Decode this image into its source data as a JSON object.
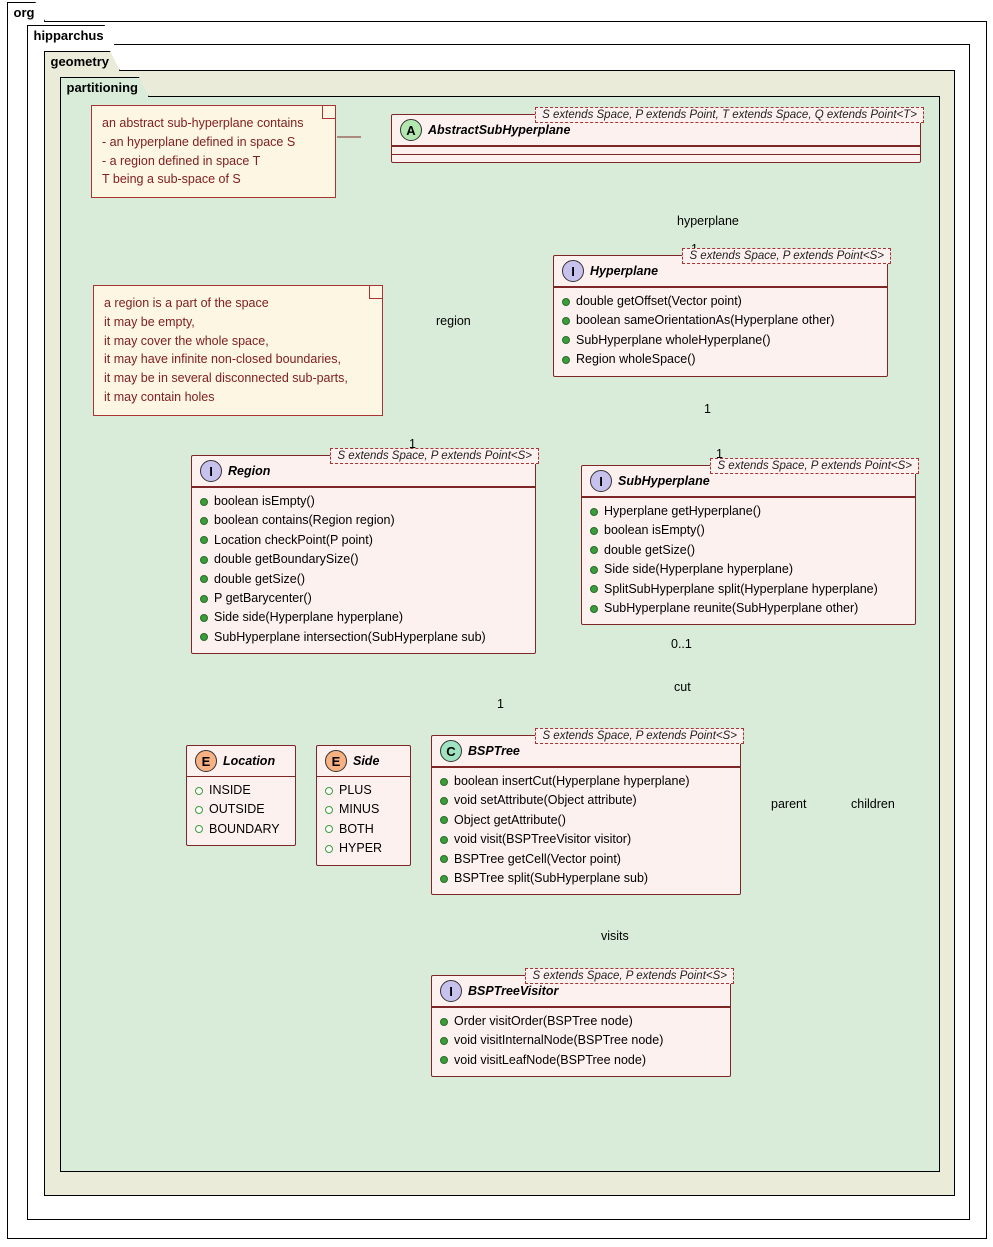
{
  "packages": {
    "org": "org",
    "hip": "hipparchus",
    "geo": "geometry",
    "part": "partitioning"
  },
  "notes": {
    "ash": [
      "an abstract sub-hyperplane contains",
      " - an hyperplane defined in space S",
      " - a region defined in space T",
      "T being a sub-space of S"
    ],
    "region": [
      "a region is a part of the space",
      "it may be empty,",
      "it may cover the whole space,",
      "it may have infinite non-closed boundaries,",
      "it may be in several disconnected sub-parts,",
      "it may contain holes"
    ]
  },
  "classes": {
    "ash": {
      "stereo": "A",
      "name": "AbstractSubHyperplane",
      "generic": "S extends Space, P extends Point, T extends Space, Q extends Point<T>"
    },
    "hyp": {
      "stereo": "I",
      "name": "Hyperplane",
      "generic": "S extends Space, P extends Point<S>",
      "members": [
        "double getOffset(Vector point)",
        "boolean sameOrientationAs(Hyperplane other)",
        "SubHyperplane wholeHyperplane()",
        "Region wholeSpace()"
      ]
    },
    "region": {
      "stereo": "I",
      "name": "Region",
      "generic": "S extends Space, P extends Point<S>",
      "members": [
        "boolean isEmpty()",
        "boolean contains(Region region)",
        "Location checkPoint(P point)",
        "double getBoundarySize()",
        "double getSize()",
        "P getBarycenter()",
        "Side side(Hyperplane hyperplane)",
        "SubHyperplane intersection(SubHyperplane sub)"
      ]
    },
    "sub": {
      "stereo": "I",
      "name": "SubHyperplane",
      "generic": "S extends Space, P extends Point<S>",
      "members": [
        "Hyperplane getHyperplane()",
        "boolean isEmpty()",
        "double getSize()",
        "Side side(Hyperplane hyperplane)",
        "SplitSubHyperplane split(Hyperplane hyperplane)",
        "SubHyperplane reunite(SubHyperplane other)"
      ]
    },
    "loc": {
      "stereo": "E",
      "name": "Location",
      "members": [
        "INSIDE",
        "OUTSIDE",
        "BOUNDARY"
      ]
    },
    "side": {
      "stereo": "E",
      "name": "Side",
      "members": [
        "PLUS",
        "MINUS",
        "BOTH",
        "HYPER"
      ]
    },
    "bsp": {
      "stereo": "C",
      "name": "BSPTree",
      "generic": "S extends Space, P extends Point<S>",
      "members": [
        "boolean insertCut(Hyperplane hyperplane)",
        "void setAttribute(Object attribute)",
        "Object getAttribute()",
        "void visit(BSPTreeVisitor visitor)",
        "BSPTree getCell(Vector point)",
        "BSPTree split(SubHyperplane sub)"
      ]
    },
    "vis": {
      "stereo": "I",
      "name": "BSPTreeVisitor",
      "generic": "S extends Space, P extends Point<S>",
      "members": [
        "Order visitOrder(BSPTree node)",
        "void visitInternalNode(BSPTree node)",
        "void visitLeafNode(BSPTree node)"
      ]
    }
  },
  "labels": {
    "hyperplane": "hyperplane",
    "region": "region",
    "cut": "cut",
    "visits": "visits",
    "parent": "parent",
    "children": "children",
    "one": "1",
    "zero_one": "0..1"
  }
}
